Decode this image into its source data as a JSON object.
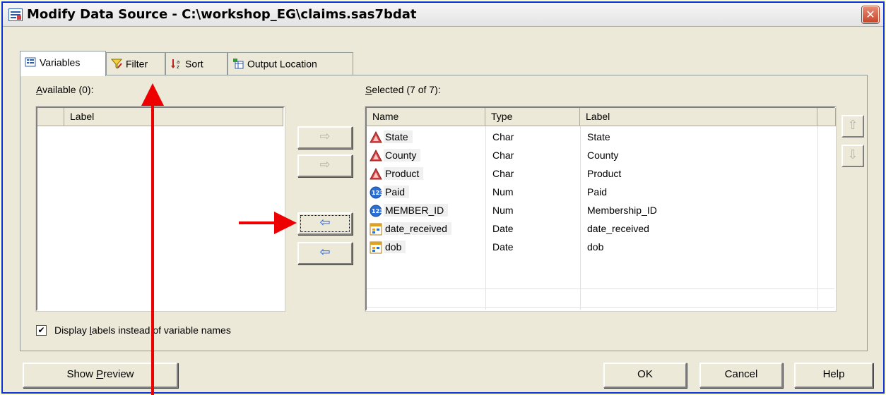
{
  "window": {
    "title": "Modify Data Source - C:\\workshop_EG\\claims.sas7bdat",
    "close_glyph": "✕"
  },
  "tabs": [
    {
      "label": "Variables",
      "icon": "variables-list-icon",
      "active": true
    },
    {
      "label": "Filter",
      "icon": "funnel-icon",
      "active": false
    },
    {
      "label": "Sort",
      "icon": "sort-icon",
      "active": false
    },
    {
      "label": "Output Location",
      "icon": "output-table-icon",
      "active": false
    }
  ],
  "available": {
    "label_prefix": "A",
    "label_rest": "vailable (0):",
    "columns": [
      "",
      "Label"
    ],
    "rows": []
  },
  "selected": {
    "label_prefix": "S",
    "label_rest": "elected (7 of 7):",
    "columns": [
      "Name",
      "Type",
      "Label"
    ],
    "rows": [
      {
        "name": "State",
        "type": "Char",
        "label": "State",
        "icon": "char-icon"
      },
      {
        "name": "County",
        "type": "Char",
        "label": "County",
        "icon": "char-icon"
      },
      {
        "name": "Product",
        "type": "Char",
        "label": "Product",
        "icon": "char-icon"
      },
      {
        "name": "Paid",
        "type": "Num",
        "label": "Paid",
        "icon": "num-icon"
      },
      {
        "name": "MEMBER_ID",
        "type": "Num",
        "label": "Membership_ID",
        "icon": "num-icon"
      },
      {
        "name": "date_received",
        "type": "Date",
        "label": "date_received",
        "icon": "date-icon"
      },
      {
        "name": "dob",
        "type": "Date",
        "label": "dob",
        "icon": "date-icon"
      }
    ]
  },
  "move_buttons": {
    "add_glyph": "⇨",
    "add_all_glyph": "⇨",
    "remove_glyph": "⇦",
    "remove_all_glyph": "⇦"
  },
  "order_buttons": {
    "up_glyph": "⇧",
    "down_glyph": "⇩"
  },
  "display_labels": {
    "checked": true,
    "check_glyph": "✔",
    "pre": "Display ",
    "mnemonic": "l",
    "post": "abels instead of variable names"
  },
  "buttons": {
    "preview_pre": "Show ",
    "preview_mnemonic": "P",
    "preview_post": "review",
    "ok": "OK",
    "cancel": "Cancel",
    "help": "Help"
  },
  "colors": {
    "annotation_arrow": "#ee0000",
    "char_icon": "#d94040",
    "num_icon": "#2a6fd6",
    "date_icon": "#e0a020"
  }
}
